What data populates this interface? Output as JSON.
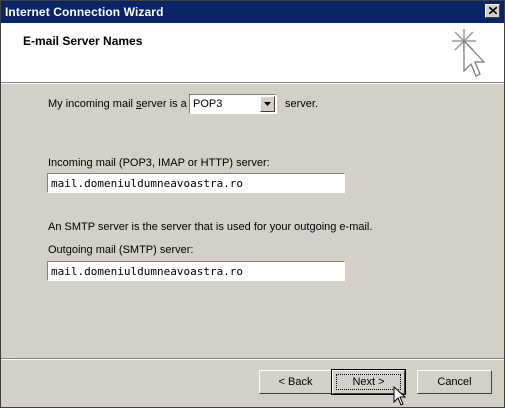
{
  "window": {
    "title": "Internet Connection Wizard"
  },
  "header": {
    "title": "E-mail Server Names"
  },
  "incoming_type": {
    "prefix": "My incoming mail server is a",
    "selected": "POP3",
    "suffix": "server."
  },
  "incoming": {
    "label": "Incoming mail (POP3, IMAP or HTTP) server:",
    "value": "mail.domeniuldumneavoastra.ro"
  },
  "smtp_note": "An SMTP server is the server that is used for your outgoing e-mail.",
  "outgoing": {
    "label": "Outgoing mail (SMTP) server:",
    "value": "mail.domeniuldumneavoastra.ro"
  },
  "buttons": {
    "back": "< Back",
    "next": "Next >",
    "cancel": "Cancel"
  },
  "icons": {
    "close": "close-icon",
    "wizard": "wizard-sparkle-cursor-icon",
    "dropdown": "chevron-down-icon",
    "pointer": "mouse-pointer-icon"
  }
}
